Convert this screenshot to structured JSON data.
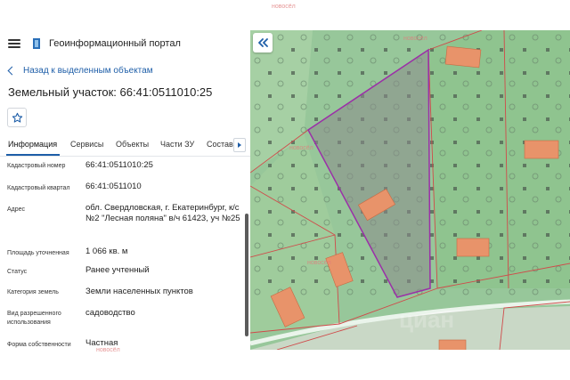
{
  "watermark": "новосёл",
  "header": {
    "title": "Геоинформационный портал"
  },
  "back_link": "Назад к выделенным объектам",
  "parcel_title": "Земельный участок: 66:41:0511010:25",
  "tabs": [
    {
      "label": "Информация",
      "active": true
    },
    {
      "label": "Сервисы"
    },
    {
      "label": "Объекты"
    },
    {
      "label": "Части ЗУ"
    },
    {
      "label": "Состав"
    }
  ],
  "properties": [
    {
      "label": "Кадастровый номер",
      "value": "66:41:0511010:25"
    },
    {
      "label": "Кадастровый квартал",
      "value": "66:41:0511010"
    },
    {
      "label": "Адрес",
      "value": "обл. Свердловская, г. Екатеринбург, к/с №2 \"Лесная поляна\" в/ч 61423, уч №25"
    },
    {
      "label": "Площадь уточненная",
      "value": "1 066 кв. м"
    },
    {
      "label": "Статус",
      "value": "Ранее учтенный"
    },
    {
      "label": "Категория земель",
      "value": "Земли населенных пунктов"
    },
    {
      "label": "Вид разрешенного использования",
      "value": "садоводство"
    },
    {
      "label": "Форма собственности",
      "value": "Частная"
    }
  ],
  "map_watermark": "циан",
  "colors": {
    "accent": "#1e5ea8",
    "parcel_outline": "#9b2fa8",
    "map_green": "#97c79a",
    "building": "#e8936a"
  }
}
